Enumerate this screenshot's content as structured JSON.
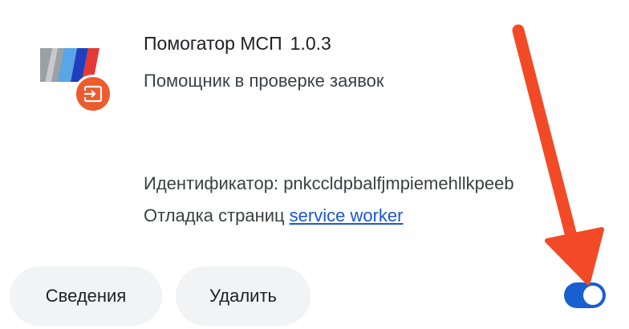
{
  "extension": {
    "name": "Помогатор МСП",
    "version": "1.0.3",
    "description": "Помощник в проверке заявок",
    "id_label": "Идентификатор:",
    "id_value": "pnkccldpbalfjmpiemehllkpeeb",
    "debug_label": "Отладка страниц",
    "debug_link": "service worker",
    "enabled": true
  },
  "actions": {
    "details_label": "Сведения",
    "remove_label": "Удалить"
  },
  "icons": {
    "extension_logo": "msp-logo-icon",
    "badge": "enterprise-policy-icon",
    "annotation": "red-arrow-icon"
  },
  "colors": {
    "badge": "#ee5b2c",
    "toggle_on": "#1a5fd1",
    "link": "#1a56d6",
    "button_bg": "#f1f3f4",
    "annotation_arrow": "#f24a26"
  }
}
